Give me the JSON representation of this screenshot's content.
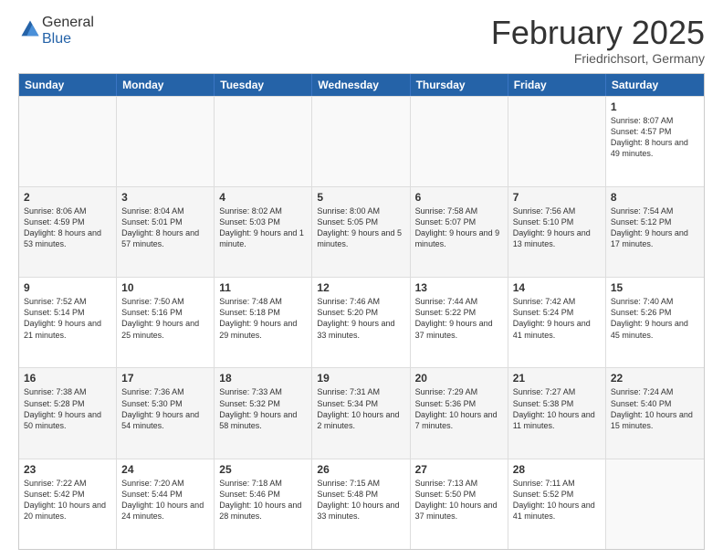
{
  "logo": {
    "general": "General",
    "blue": "Blue"
  },
  "title": "February 2025",
  "location": "Friedrichsort, Germany",
  "header_days": [
    "Sunday",
    "Monday",
    "Tuesday",
    "Wednesday",
    "Thursday",
    "Friday",
    "Saturday"
  ],
  "rows": [
    [
      {
        "day": "",
        "empty": true
      },
      {
        "day": "",
        "empty": true
      },
      {
        "day": "",
        "empty": true
      },
      {
        "day": "",
        "empty": true
      },
      {
        "day": "",
        "empty": true
      },
      {
        "day": "",
        "empty": true
      },
      {
        "day": "1",
        "text": "Sunrise: 8:07 AM\nSunset: 4:57 PM\nDaylight: 8 hours and 49 minutes."
      }
    ],
    [
      {
        "day": "2",
        "text": "Sunrise: 8:06 AM\nSunset: 4:59 PM\nDaylight: 8 hours and 53 minutes."
      },
      {
        "day": "3",
        "text": "Sunrise: 8:04 AM\nSunset: 5:01 PM\nDaylight: 8 hours and 57 minutes."
      },
      {
        "day": "4",
        "text": "Sunrise: 8:02 AM\nSunset: 5:03 PM\nDaylight: 9 hours and 1 minute."
      },
      {
        "day": "5",
        "text": "Sunrise: 8:00 AM\nSunset: 5:05 PM\nDaylight: 9 hours and 5 minutes."
      },
      {
        "day": "6",
        "text": "Sunrise: 7:58 AM\nSunset: 5:07 PM\nDaylight: 9 hours and 9 minutes."
      },
      {
        "day": "7",
        "text": "Sunrise: 7:56 AM\nSunset: 5:10 PM\nDaylight: 9 hours and 13 minutes."
      },
      {
        "day": "8",
        "text": "Sunrise: 7:54 AM\nSunset: 5:12 PM\nDaylight: 9 hours and 17 minutes."
      }
    ],
    [
      {
        "day": "9",
        "text": "Sunrise: 7:52 AM\nSunset: 5:14 PM\nDaylight: 9 hours and 21 minutes."
      },
      {
        "day": "10",
        "text": "Sunrise: 7:50 AM\nSunset: 5:16 PM\nDaylight: 9 hours and 25 minutes."
      },
      {
        "day": "11",
        "text": "Sunrise: 7:48 AM\nSunset: 5:18 PM\nDaylight: 9 hours and 29 minutes."
      },
      {
        "day": "12",
        "text": "Sunrise: 7:46 AM\nSunset: 5:20 PM\nDaylight: 9 hours and 33 minutes."
      },
      {
        "day": "13",
        "text": "Sunrise: 7:44 AM\nSunset: 5:22 PM\nDaylight: 9 hours and 37 minutes."
      },
      {
        "day": "14",
        "text": "Sunrise: 7:42 AM\nSunset: 5:24 PM\nDaylight: 9 hours and 41 minutes."
      },
      {
        "day": "15",
        "text": "Sunrise: 7:40 AM\nSunset: 5:26 PM\nDaylight: 9 hours and 45 minutes."
      }
    ],
    [
      {
        "day": "16",
        "text": "Sunrise: 7:38 AM\nSunset: 5:28 PM\nDaylight: 9 hours and 50 minutes."
      },
      {
        "day": "17",
        "text": "Sunrise: 7:36 AM\nSunset: 5:30 PM\nDaylight: 9 hours and 54 minutes."
      },
      {
        "day": "18",
        "text": "Sunrise: 7:33 AM\nSunset: 5:32 PM\nDaylight: 9 hours and 58 minutes."
      },
      {
        "day": "19",
        "text": "Sunrise: 7:31 AM\nSunset: 5:34 PM\nDaylight: 10 hours and 2 minutes."
      },
      {
        "day": "20",
        "text": "Sunrise: 7:29 AM\nSunset: 5:36 PM\nDaylight: 10 hours and 7 minutes."
      },
      {
        "day": "21",
        "text": "Sunrise: 7:27 AM\nSunset: 5:38 PM\nDaylight: 10 hours and 11 minutes."
      },
      {
        "day": "22",
        "text": "Sunrise: 7:24 AM\nSunset: 5:40 PM\nDaylight: 10 hours and 15 minutes."
      }
    ],
    [
      {
        "day": "23",
        "text": "Sunrise: 7:22 AM\nSunset: 5:42 PM\nDaylight: 10 hours and 20 minutes."
      },
      {
        "day": "24",
        "text": "Sunrise: 7:20 AM\nSunset: 5:44 PM\nDaylight: 10 hours and 24 minutes."
      },
      {
        "day": "25",
        "text": "Sunrise: 7:18 AM\nSunset: 5:46 PM\nDaylight: 10 hours and 28 minutes."
      },
      {
        "day": "26",
        "text": "Sunrise: 7:15 AM\nSunset: 5:48 PM\nDaylight: 10 hours and 33 minutes."
      },
      {
        "day": "27",
        "text": "Sunrise: 7:13 AM\nSunset: 5:50 PM\nDaylight: 10 hours and 37 minutes."
      },
      {
        "day": "28",
        "text": "Sunrise: 7:11 AM\nSunset: 5:52 PM\nDaylight: 10 hours and 41 minutes."
      },
      {
        "day": "",
        "empty": true
      }
    ]
  ]
}
